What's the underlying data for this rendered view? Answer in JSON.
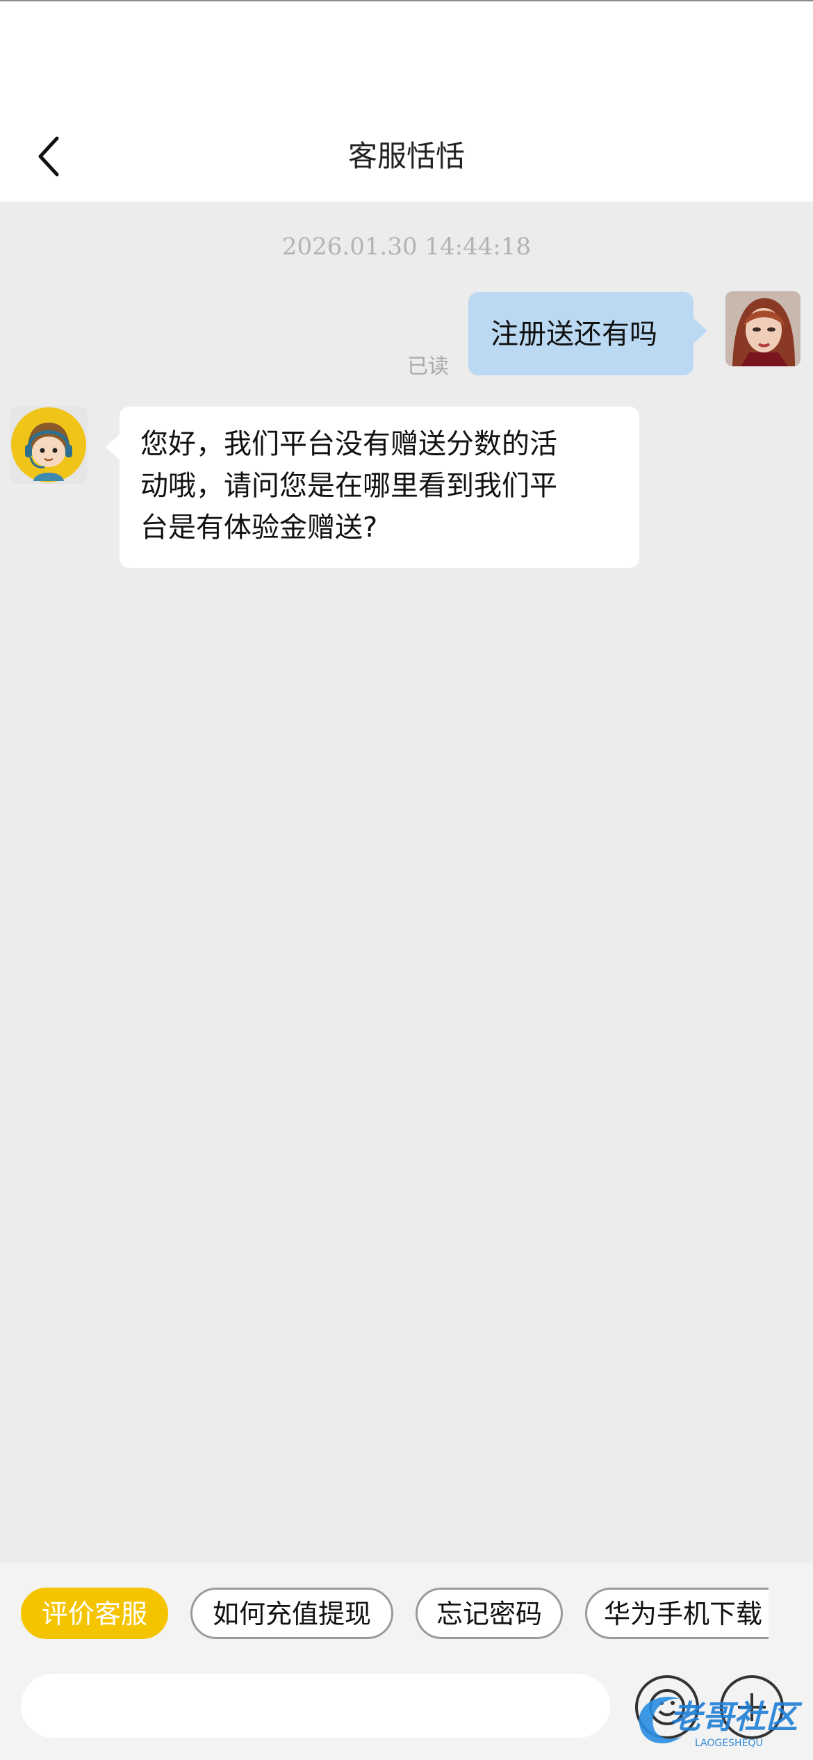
{
  "header": {
    "title": "客服恬恬",
    "back_icon": "chevron-left-icon"
  },
  "chat": {
    "timestamp": "2026.01.30 14:44:18",
    "messages": [
      {
        "sender": "user",
        "text": "注册送还有吗",
        "status": "已读",
        "bubble_color": "#bcd9f4"
      },
      {
        "sender": "agent",
        "lines": [
          "您好，我们平台没有赠送分数的活",
          "动哦，请问您是在哪里看到我们平",
          "台是有体验金赠送?"
        ],
        "bubble_color": "#ffffff"
      }
    ]
  },
  "quick_replies": [
    {
      "label": "评价客服",
      "primary": true
    },
    {
      "label": "如何充值提现",
      "primary": false
    },
    {
      "label": "忘记密码",
      "primary": false
    },
    {
      "label": "华为手机下载",
      "primary": false
    }
  ],
  "composer": {
    "placeholder": "",
    "emoji_icon": "emoji-icon",
    "plus_icon": "plus-icon"
  },
  "watermark": {
    "title": "老哥社区",
    "subtitle": "LAOGESHEQU"
  },
  "colors": {
    "accent": "#f5c400",
    "background": "#ececec",
    "user_bubble": "#bcd9f4"
  }
}
